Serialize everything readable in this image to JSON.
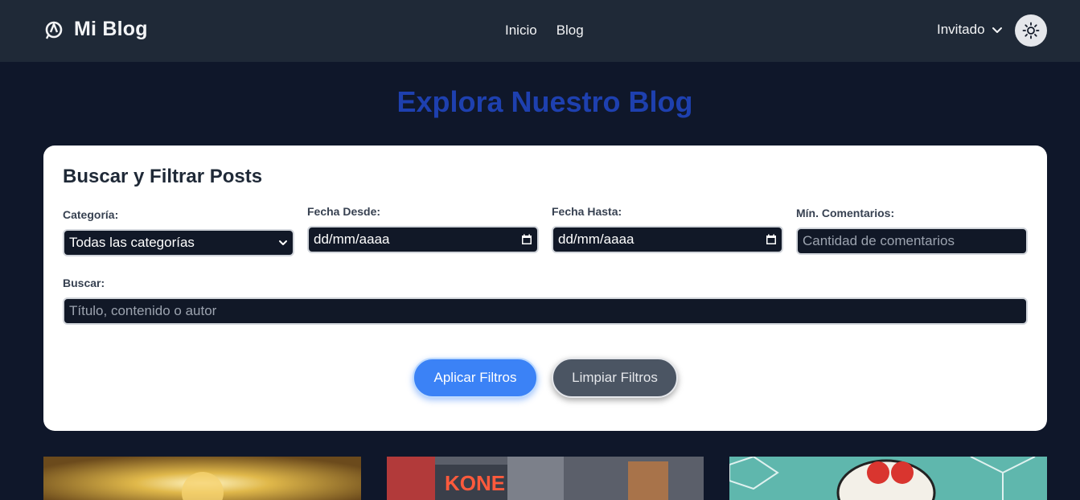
{
  "navbar": {
    "brand": "Mi Blog",
    "brand_icon": "logo-icon",
    "links": [
      "Inicio",
      "Blog"
    ],
    "user_label": "Invitado",
    "user_icon": "chevron-down-icon",
    "theme_icon": "sun-icon"
  },
  "hero": {
    "title": "Explora Nuestro Blog"
  },
  "filters": {
    "title": "Buscar y Filtrar Posts",
    "category": {
      "label": "Categoría:",
      "value": "Todas las categorías"
    },
    "date_from": {
      "label": "Fecha Desde:",
      "value": "dd/mm/aaaa"
    },
    "date_to": {
      "label": "Fecha Hasta:",
      "value": "dd/mm/aaaa"
    },
    "min_comments": {
      "label": "Mín. Comentarios:",
      "placeholder": "Cantidad de comentarios"
    },
    "search": {
      "label": "Buscar:",
      "placeholder": "Título, contenido o autor"
    },
    "apply_label": "Aplicar Filtros",
    "clear_label": "Limpiar Filtros"
  },
  "colors": {
    "page_bg": "#0f172a",
    "navbar_bg": "#1f2937",
    "title_accent": "#1e40af",
    "primary_button": "#3b82f6",
    "secondary_button": "#4b5563"
  },
  "posts": [
    {
      "image_icon": "sunlight-photo"
    },
    {
      "image_icon": "street-sign-photo"
    },
    {
      "image_icon": "illustration-photo"
    }
  ]
}
